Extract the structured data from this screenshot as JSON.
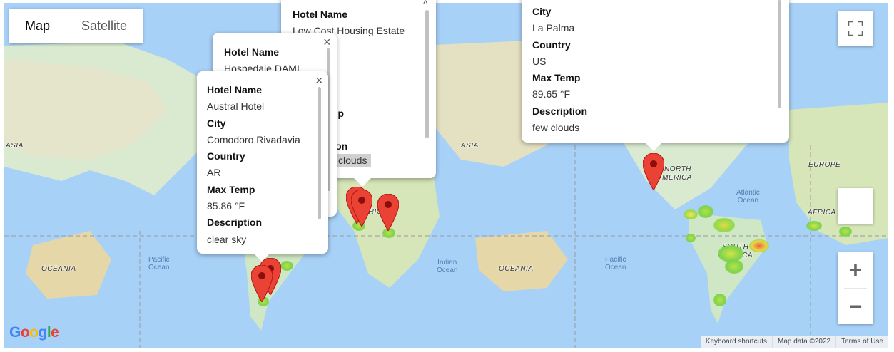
{
  "map_type": {
    "map": "Map",
    "satellite": "Satellite",
    "active": "map"
  },
  "labels": {
    "continents": [
      "ASIA",
      "ASIA",
      "OCEANIA",
      "OCEANIA",
      "NORTH",
      "AMERICA",
      "SOUTH",
      "AMERICA",
      "EUROPE",
      "AFRICA",
      "AFRICA"
    ],
    "oceans": {
      "pacific_1": "Pacific\nOcean",
      "pacific_2": "Pacific\nOcean",
      "indian": "Indian\nOcean",
      "atlantic": "Atlantic\nOcean"
    }
  },
  "infowindows": [
    {
      "fields": [
        {
          "label": "Hotel Name",
          "value": "Low Cost Housing Estate"
        },
        {
          "label": "Max Temp",
          "value": ""
        },
        {
          "label": "Description",
          "value": "clouds"
        }
      ],
      "visible_fragments": {
        "temp_tail": "np",
        "desc_tail": "ption"
      }
    },
    {
      "fields": [
        {
          "label": "Hotel Name",
          "value": "Hospedaje DAMI"
        }
      ]
    },
    {
      "fields": [
        {
          "label": "Hotel Name",
          "value": "Austral Hotel"
        },
        {
          "label": "City",
          "value": "Comodoro Rivadavia"
        },
        {
          "label": "Country",
          "value": "AR"
        },
        {
          "label": "Max Temp",
          "value": "85.86 °F"
        },
        {
          "label": "Description",
          "value": "clear sky"
        }
      ]
    },
    {
      "fields": [
        {
          "label": "City",
          "value": "La Palma"
        },
        {
          "label": "Country",
          "value": "US"
        },
        {
          "label": "Max Temp",
          "value": "89.65 °F"
        },
        {
          "label": "Description",
          "value": "few clouds"
        }
      ]
    }
  ],
  "controls": {
    "zoom_in": "+",
    "zoom_out": "−"
  },
  "footer": {
    "shortcuts": "Keyboard shortcuts",
    "data": "Map data ©2022",
    "terms": "Terms of Use"
  },
  "logo": "Google",
  "colors": {
    "marker": "#ea4335",
    "marker_dark": "#b31412",
    "water": "#a8d1f7",
    "land": "#cfe7c4"
  }
}
